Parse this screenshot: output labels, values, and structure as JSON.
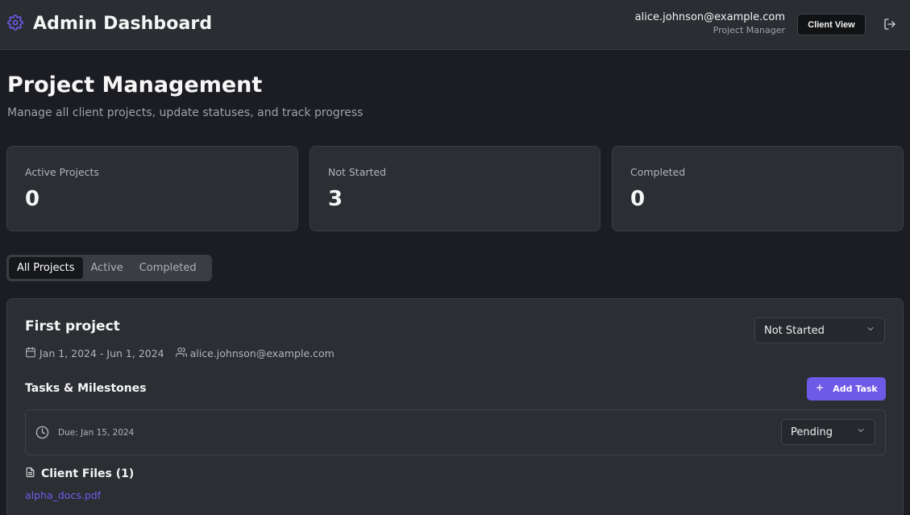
{
  "header": {
    "title": "Admin Dashboard",
    "user_email": "alice.johnson@example.com",
    "user_role": "Project Manager",
    "client_view_label": "Client View",
    "accent_color": "#6f5ae8"
  },
  "page": {
    "title": "Project Management",
    "subtitle": "Manage all client projects, update statuses, and track progress"
  },
  "stats": [
    {
      "label": "Active Projects",
      "value": "0"
    },
    {
      "label": "Not Started",
      "value": "3"
    },
    {
      "label": "Completed",
      "value": "0"
    }
  ],
  "tabs": [
    {
      "label": "All Projects",
      "active": true
    },
    {
      "label": "Active",
      "active": false
    },
    {
      "label": "Completed",
      "active": false
    }
  ],
  "project": {
    "name": "First project",
    "dates": "Jan 1, 2024 - Jun 1, 2024",
    "owner": "alice.johnson@example.com",
    "status": "Not Started",
    "tasks_title": "Tasks & Milestones",
    "add_task_label": "Add Task",
    "task": {
      "due": "Due: Jan 15, 2024",
      "status": "Pending"
    },
    "files_title": "Client Files (1)",
    "file_name": "alpha_docs.pdf",
    "link_color": "#6d5ef0"
  },
  "icons": {
    "brand": "gear-icon",
    "logout": "logout-icon",
    "calendar": "calendar-icon",
    "users": "users-icon",
    "chevron": "chevron-down-icon",
    "plus": "plus-icon",
    "clock": "clock-icon",
    "file": "file-icon"
  }
}
